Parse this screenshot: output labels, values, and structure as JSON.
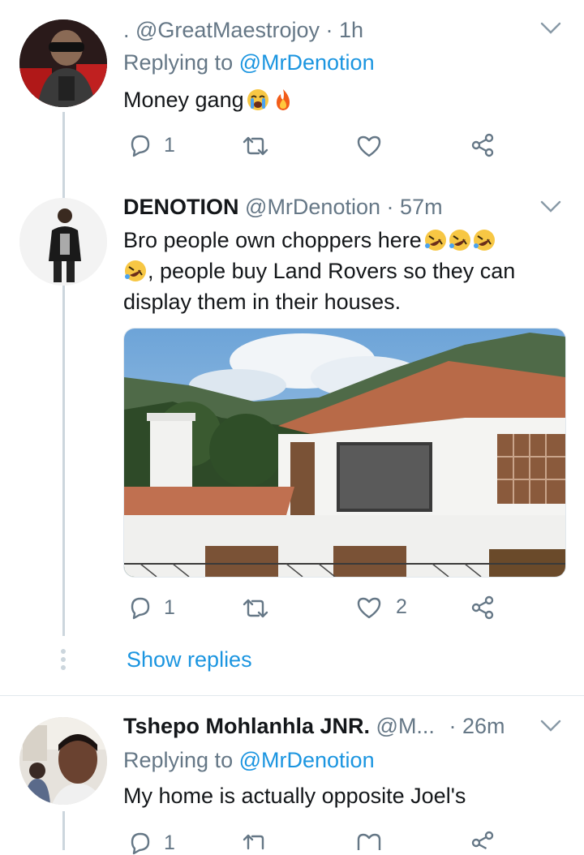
{
  "tweets": [
    {
      "handle_line": ". @GreatMaestrojoy",
      "time": "1h",
      "replying_prefix": "Replying to",
      "replying_to": "@MrDenotion",
      "text": "Money gang",
      "emoji": [
        "crying-face",
        "fire"
      ],
      "replies": "1",
      "retweets": "",
      "likes": ""
    },
    {
      "name": "DENOTION",
      "handle": "@MrDenotion",
      "time": "57m",
      "text_line1": "Bro people own choppers here",
      "text_line2": ", people buy Land Rovers so they can",
      "text_line3": "display them in their houses.",
      "emoji": [
        "rofl-face",
        "rofl-face",
        "rofl-face",
        "rofl-face"
      ],
      "has_image": true,
      "image_subject": "house",
      "replies": "1",
      "retweets": "",
      "likes": "2"
    },
    {
      "name": "Tshepo Mohlanhla JNR.",
      "handle": "@M...",
      "time": "26m",
      "replying_prefix": "Replying to",
      "replying_to": "@MrDenotion",
      "text": "My home is actually opposite Joel's",
      "replies": "1",
      "retweets": "",
      "likes": ""
    }
  ],
  "show_replies": "Show replies",
  "separator": "·",
  "colors": {
    "text": "#14171a",
    "secondary": "#657786",
    "link": "#1b95e0",
    "thread_line": "#ccd6dd"
  },
  "icons": [
    "reply-icon",
    "retweet-icon",
    "like-icon",
    "share-icon",
    "chevron-down-icon"
  ]
}
